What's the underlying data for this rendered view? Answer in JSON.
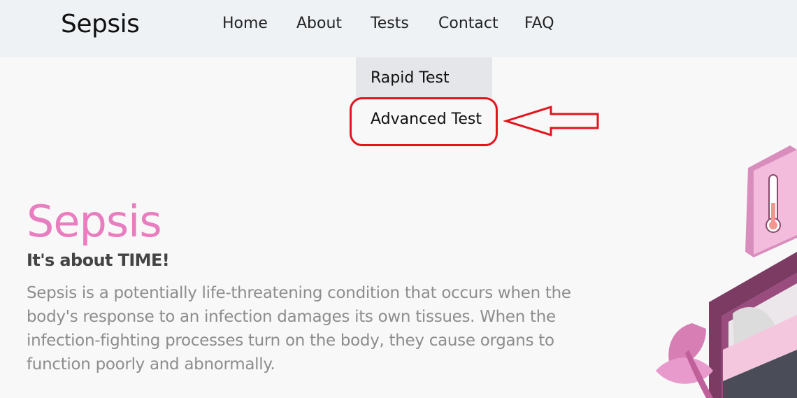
{
  "navbar": {
    "brand": "Sepsis",
    "links": [
      "Home",
      "About",
      "Tests",
      "Contact",
      "FAQ"
    ]
  },
  "dropdown": {
    "items": [
      "Rapid Test",
      "Advanced Test"
    ]
  },
  "hero": {
    "title": "Sepsis",
    "subtitle": "It's about TIME!",
    "text": "Sepsis is a potentially life-threatening condition that occurs when the body's response to an infection damages its own tissues. When the infection-fighting processes turn on the body, they cause organs to function poorly and abnormally."
  },
  "colors": {
    "accent": "#e87ec0",
    "annotation": "#e3141c",
    "navbar_bg": "#eff2f5"
  }
}
